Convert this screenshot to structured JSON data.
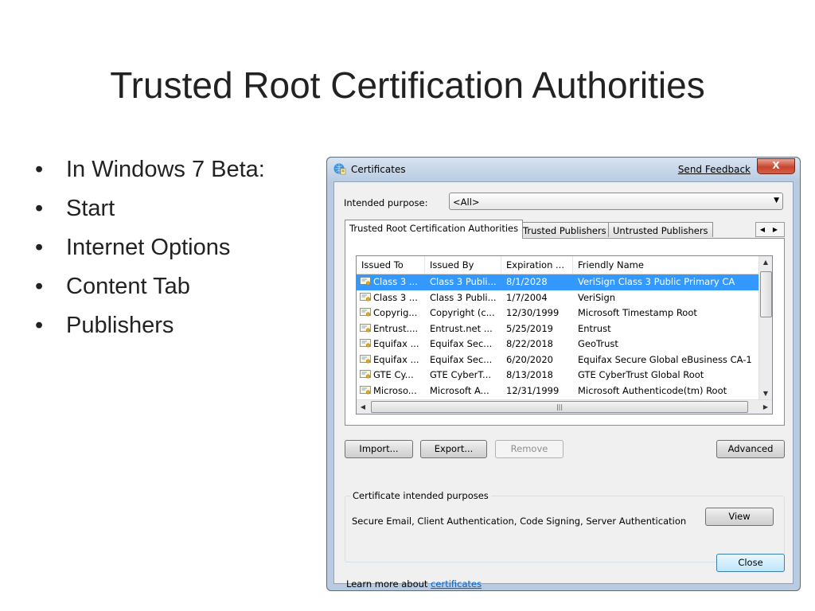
{
  "slide": {
    "title": "Trusted Root Certification Authorities",
    "bullets": [
      "In Windows 7 Beta:",
      "Start",
      "Internet Options",
      "Content Tab",
      "Publishers"
    ],
    "bullet_char": "•"
  },
  "dialog": {
    "title": "Certificates",
    "send_feedback": "Send Feedback",
    "close_glyph": "X",
    "intended_purpose_label": "Intended purpose:",
    "intended_purpose_value": "<All>",
    "tabs": [
      {
        "label": "Trusted Root Certification Authorities",
        "active": true
      },
      {
        "label": "Trusted Publishers",
        "active": false
      },
      {
        "label": "Untrusted Publishers",
        "active": false
      }
    ],
    "columns": [
      "Issued To",
      "Issued By",
      "Expiration ...",
      "Friendly Name"
    ],
    "rows": [
      {
        "issued_to": "Class 3 ...",
        "issued_by": "Class 3 Publi...",
        "expiration": "8/1/2028",
        "friendly": "VeriSign Class 3 Public Primary CA",
        "selected": true
      },
      {
        "issued_to": "Class 3 ...",
        "issued_by": "Class 3 Publi...",
        "expiration": "1/7/2004",
        "friendly": "VeriSign",
        "selected": false
      },
      {
        "issued_to": "Copyrig...",
        "issued_by": "Copyright (c...",
        "expiration": "12/30/1999",
        "friendly": "Microsoft Timestamp Root",
        "selected": false
      },
      {
        "issued_to": "Entrust....",
        "issued_by": "Entrust.net ...",
        "expiration": "5/25/2019",
        "friendly": "Entrust",
        "selected": false
      },
      {
        "issued_to": "Equifax ...",
        "issued_by": "Equifax Sec...",
        "expiration": "8/22/2018",
        "friendly": "GeoTrust",
        "selected": false
      },
      {
        "issued_to": "Equifax ...",
        "issued_by": "Equifax Sec...",
        "expiration": "6/20/2020",
        "friendly": "Equifax Secure Global eBusiness CA-1",
        "selected": false
      },
      {
        "issued_to": "GTE Cy...",
        "issued_by": "GTE CyberT...",
        "expiration": "8/13/2018",
        "friendly": "GTE CyberTrust Global Root",
        "selected": false
      },
      {
        "issued_to": "Microso...",
        "issued_by": "Microsoft A...",
        "expiration": "12/31/1999",
        "friendly": "Microsoft Authenticode(tm) Root",
        "selected": false
      }
    ],
    "buttons": {
      "import": "Import...",
      "export": "Export...",
      "remove": "Remove",
      "advanced": "Advanced",
      "view": "View",
      "close": "Close"
    },
    "purposes_group_title": "Certificate intended purposes",
    "purposes_text": "Secure Email, Client Authentication, Code Signing, Server Authentication",
    "learn_more_prefix": "Learn more about ",
    "learn_more_link": "certificates",
    "icons": {
      "title_icon": "certificate-manager-icon",
      "row_icon": "certificate-icon"
    },
    "colors": {
      "selection": "#3399ff",
      "link": "#0066cc",
      "frame": "#b9cbe0",
      "close_button": "#c7452f"
    }
  }
}
